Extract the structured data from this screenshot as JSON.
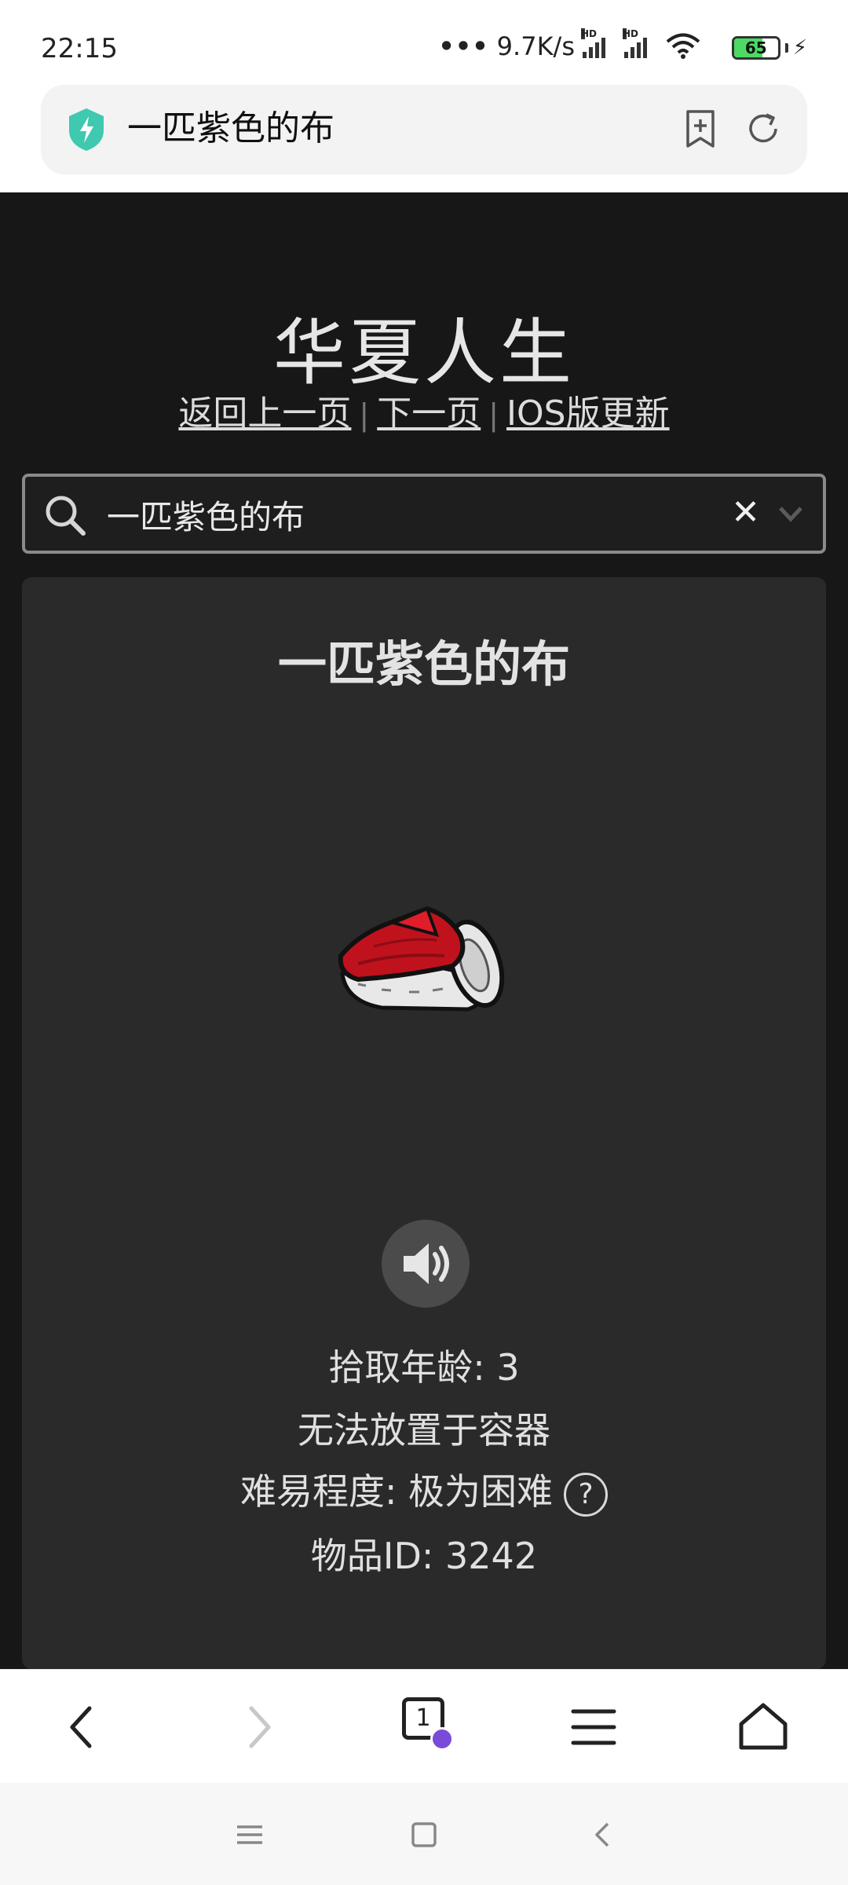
{
  "status_bar": {
    "time": "22:15",
    "net_speed": "9.7K/s",
    "hd1": "HD",
    "hd2": "HD",
    "battery": "65",
    "battery_level": 0.65
  },
  "url_bar": {
    "title": "一匹紫色的布",
    "icons": [
      "shield-bolt-icon",
      "bookmark-add-icon",
      "reload-icon"
    ]
  },
  "page": {
    "site_title": "华夏人生",
    "nav": {
      "back": "返回上一页",
      "next": "下一页",
      "ios": "IOS版更新"
    },
    "search": {
      "value": "一匹紫色的布",
      "clear": "✕"
    },
    "item": {
      "name": "一匹紫色的布",
      "pickup_age": "拾取年龄: 3",
      "container": "无法放置于容器",
      "difficulty": "难易程度: 极为困难",
      "help": "?",
      "item_id": "物品ID: 3242"
    }
  },
  "toolbar": {
    "tab_count": "1",
    "icons": [
      "back-icon",
      "forward-icon",
      "tabs-icon",
      "menu-icon",
      "home-icon"
    ]
  },
  "colors": {
    "page_bg": "#171717",
    "card_bg": "#2a2a2a",
    "shield": "#3ec9b0",
    "cloth_red": "#c0121d",
    "tab_badge": "#7a4bd8"
  }
}
